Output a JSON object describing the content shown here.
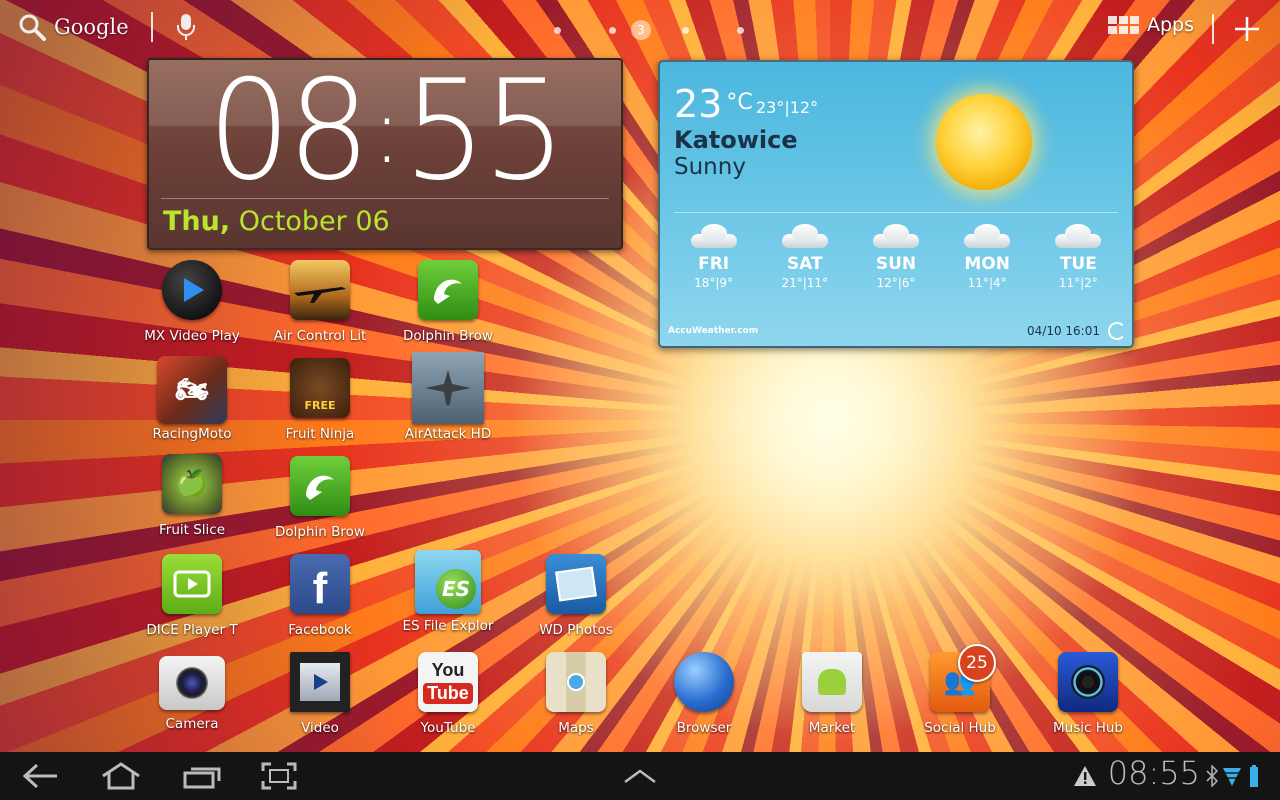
{
  "top_bar": {
    "search_label": "Google",
    "current_page": "3",
    "apps_label": "Apps"
  },
  "clock": {
    "hour": "08",
    "minute": "55",
    "day": "Thu,",
    "date": "October 06"
  },
  "weather": {
    "temp": "23",
    "unit": "°C",
    "hilo": "23°|12°",
    "city": "Katowice",
    "condition": "Sunny",
    "forecast": [
      {
        "day": "FRI",
        "range": "18°|9°"
      },
      {
        "day": "SAT",
        "range": "21°|11°"
      },
      {
        "day": "SUN",
        "range": "12°|6°"
      },
      {
        "day": "MON",
        "range": "11°|4°"
      },
      {
        "day": "TUE",
        "range": "11°|2°"
      }
    ],
    "brand": "AccuWeather.com",
    "updated": "04/10 16:01"
  },
  "apps": [
    {
      "label": "MX Video Play",
      "icon": "mx-video-player-icon"
    },
    {
      "label": "Air Control Lit",
      "icon": "air-control-icon"
    },
    {
      "label": "Dolphin Brow",
      "icon": "dolphin-browser-icon"
    },
    {
      "label": "RacingMoto",
      "icon": "racing-moto-icon"
    },
    {
      "label": "Fruit Ninja",
      "icon": "fruit-ninja-icon"
    },
    {
      "label": "AirAttack HD",
      "icon": "airattack-icon"
    },
    {
      "label": "Fruit Slice",
      "icon": "fruit-slice-icon"
    },
    {
      "label": "Dolphin Brow",
      "icon": "dolphin-browser-icon"
    },
    {
      "label": "DICE Player T",
      "icon": "dice-player-icon"
    },
    {
      "label": "Facebook",
      "icon": "facebook-icon"
    },
    {
      "label": "ES File Explor",
      "icon": "es-file-explorer-icon"
    },
    {
      "label": "WD Photos",
      "icon": "wd-photos-icon"
    }
  ],
  "dock": [
    {
      "label": "Camera",
      "icon": "camera-icon"
    },
    {
      "label": "Video",
      "icon": "video-icon"
    },
    {
      "label": "YouTube",
      "icon": "youtube-icon"
    },
    {
      "label": "Maps",
      "icon": "maps-icon"
    },
    {
      "label": "Browser",
      "icon": "browser-globe-icon"
    },
    {
      "label": "Market",
      "icon": "market-icon"
    },
    {
      "label": "Social Hub",
      "icon": "social-hub-icon",
      "badge": "25"
    },
    {
      "label": "Music Hub",
      "icon": "music-hub-icon"
    }
  ],
  "status_bar": {
    "time": "08:55"
  },
  "colors": {
    "date_accent": "#b8e62e",
    "weather_sky": "#4cb7df",
    "nav_bg": "#141414"
  }
}
